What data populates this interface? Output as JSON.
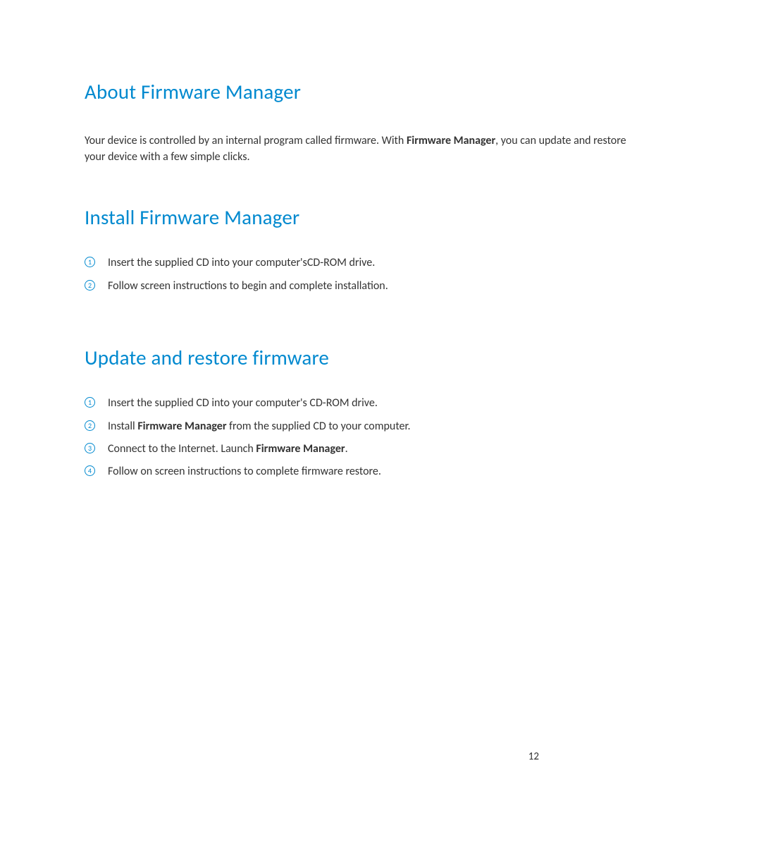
{
  "colors": {
    "heading": "#0089cf",
    "text": "#333333"
  },
  "pageNumber": "12",
  "section1": {
    "heading": "About Firmware Manager",
    "para_pre": "Your device is controlled by an internal program called firmware.  With ",
    "para_bold": "Firmware Manager",
    "para_post": ", you can update and restore your device with a few simple clicks."
  },
  "section2": {
    "heading": "Install Firmware Manager",
    "steps": [
      {
        "num": "1",
        "text": "Insert the supplied CD into your computer'sCD-ROM drive."
      },
      {
        "num": "2",
        "text": "Follow screen instructions to begin and complete installation."
      }
    ]
  },
  "section3": {
    "heading": "Update and restore firmware",
    "steps": [
      {
        "num": "1",
        "pre": "Insert the supplied CD into your computer's CD-ROM drive."
      },
      {
        "num": "2",
        "pre": "Install ",
        "bold": "Firmware Manager",
        "post": " from the supplied CD to your computer."
      },
      {
        "num": "3",
        "pre": "Connect to the Internet. Launch ",
        "bold": "Firmware Manager",
        "post": "."
      },
      {
        "num": "4",
        "pre": "Follow on screen instructions to complete firmware restore."
      }
    ]
  }
}
